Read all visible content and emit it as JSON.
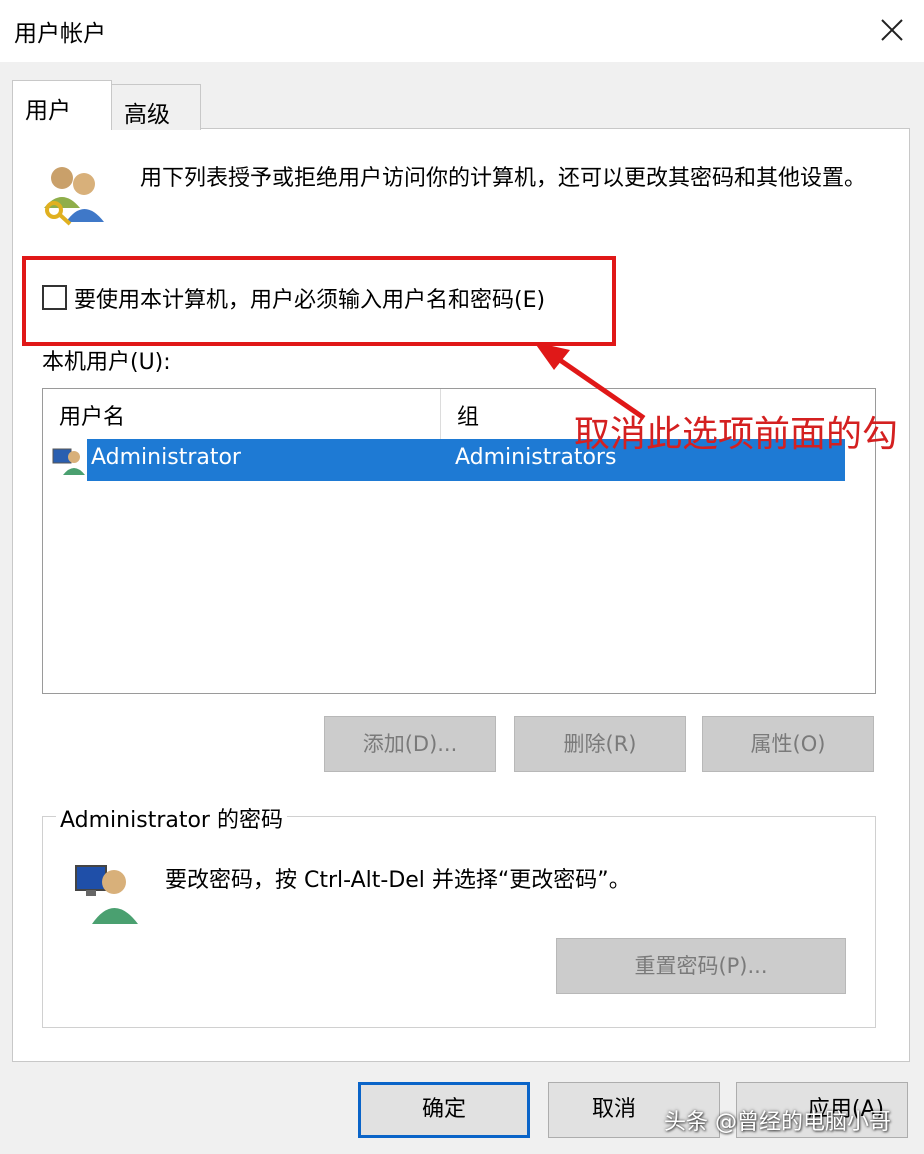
{
  "window": {
    "title": "用户帐户",
    "close_icon": "close-icon"
  },
  "tabs": [
    {
      "label": "用户",
      "selected": true
    },
    {
      "label": "高级",
      "selected": false
    }
  ],
  "intro_text": "用下列表授予或拒绝用户访问你的计算机，还可以更改其密码和其他设置。",
  "require_login": {
    "label": "要使用本计算机，用户必须输入用户名和密码(E)",
    "checked": false
  },
  "local_users": {
    "label": "本机用户(U):",
    "columns": [
      "用户名",
      "组"
    ],
    "rows": [
      {
        "name": "Administrator",
        "group": "Administrators",
        "selected": true
      }
    ]
  },
  "user_buttons": {
    "add": "添加(D)...",
    "remove": "删除(R)",
    "properties": "属性(O)"
  },
  "password_group": {
    "title": "Administrator 的密码",
    "text": "要改密码，按 Ctrl-Alt-Del 并选择“更改密码”。",
    "reset_button": "重置密码(P)..."
  },
  "dialog_buttons": {
    "ok": "确定",
    "cancel": "取消",
    "apply": "应用(A)"
  },
  "annotation": {
    "text": "取消此选项前面的勾",
    "color": "#d42020"
  },
  "watermark": "头条 @曾经的电脑小哥",
  "colors": {
    "selection": "#1e7ad4",
    "annotation_box": "#e01818",
    "default_button_border": "#0a64c8"
  }
}
